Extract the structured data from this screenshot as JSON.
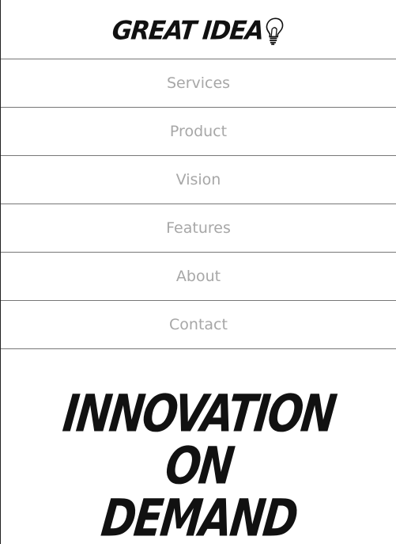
{
  "header": {
    "logo_text": "GREAT IDEA",
    "logo_icon": "lightbulb-icon"
  },
  "nav": {
    "items": [
      {
        "label": "Services"
      },
      {
        "label": "Product"
      },
      {
        "label": "Vision"
      },
      {
        "label": "Features"
      },
      {
        "label": "About"
      },
      {
        "label": "Contact"
      }
    ]
  },
  "hero": {
    "lines": [
      "INNOVATION",
      "ON",
      "DEMAND"
    ]
  },
  "colors": {
    "text_dark": "#111111",
    "nav_text": "#a7a7a7",
    "divider": "#777777",
    "background": "#ffffff"
  }
}
